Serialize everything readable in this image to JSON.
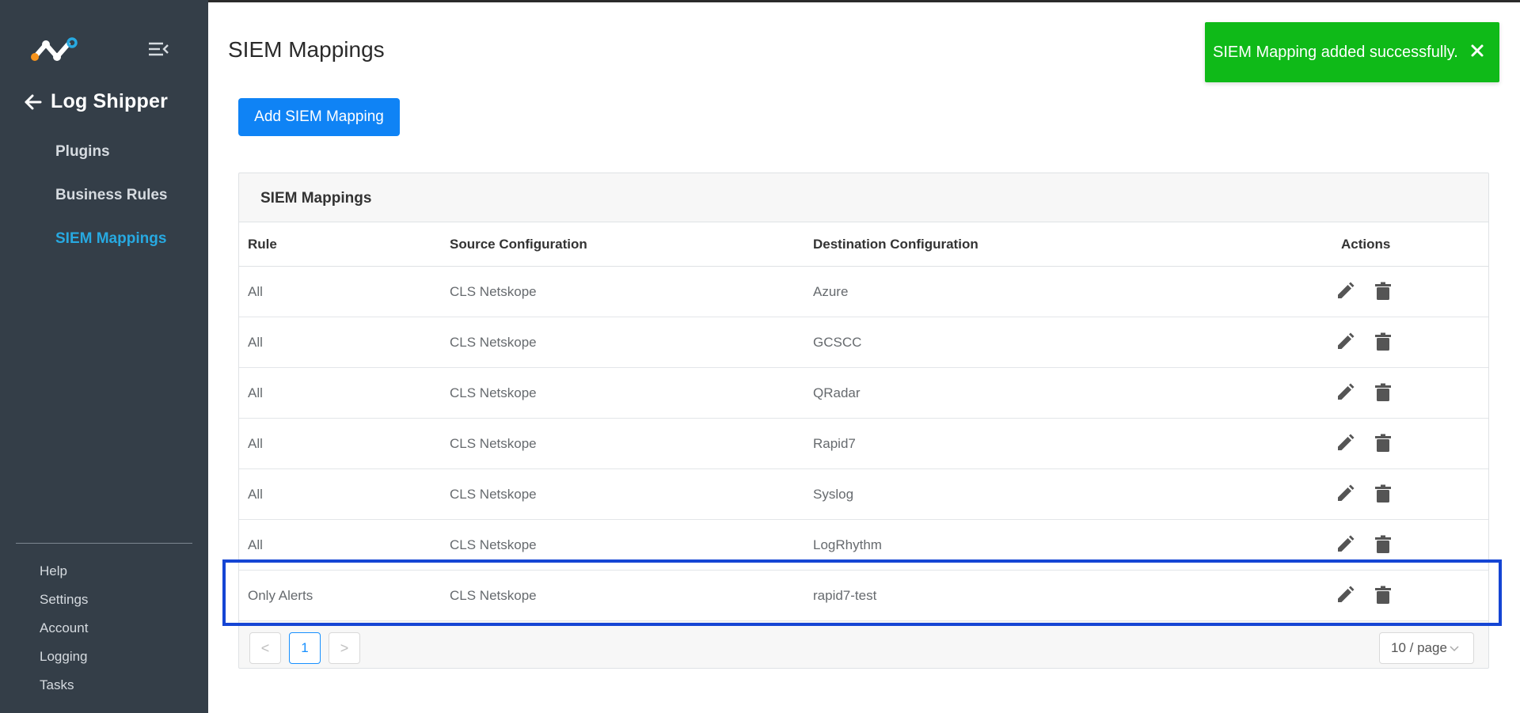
{
  "sidebar": {
    "back_title": "Log Shipper",
    "nav": [
      "Plugins",
      "Business Rules",
      "SIEM Mappings"
    ],
    "active_index": 2,
    "footer": [
      "Help",
      "Settings",
      "Account",
      "Logging",
      "Tasks"
    ]
  },
  "main": {
    "title": "SIEM Mappings",
    "add_button": "Add SIEM Mapping",
    "card_title": "SIEM Mappings",
    "columns": {
      "rule": "Rule",
      "source": "Source Configuration",
      "destination": "Destination Configuration",
      "actions": "Actions"
    },
    "rows": [
      {
        "rule": "All",
        "source": "CLS Netskope",
        "destination": "Azure"
      },
      {
        "rule": "All",
        "source": "CLS Netskope",
        "destination": "GCSCC"
      },
      {
        "rule": "All",
        "source": "CLS Netskope",
        "destination": "QRadar"
      },
      {
        "rule": "All",
        "source": "CLS Netskope",
        "destination": "Rapid7"
      },
      {
        "rule": "All",
        "source": "CLS Netskope",
        "destination": "Syslog"
      },
      {
        "rule": "All",
        "source": "CLS Netskope",
        "destination": "LogRhythm"
      },
      {
        "rule": "Only Alerts",
        "source": "CLS Netskope",
        "destination": "rapid7-test"
      }
    ],
    "pagination": {
      "prev": "<",
      "current_page": "1",
      "next": ">",
      "page_size": "10 / page"
    }
  },
  "toast": {
    "message": "SIEM Mapping added successfully.",
    "color": "#0fba18"
  },
  "colors": {
    "sidebar_bg": "#343e48",
    "active_nav": "#27a9e1",
    "primary_button": "#0f83f5",
    "highlight_border": "#1545d4"
  }
}
